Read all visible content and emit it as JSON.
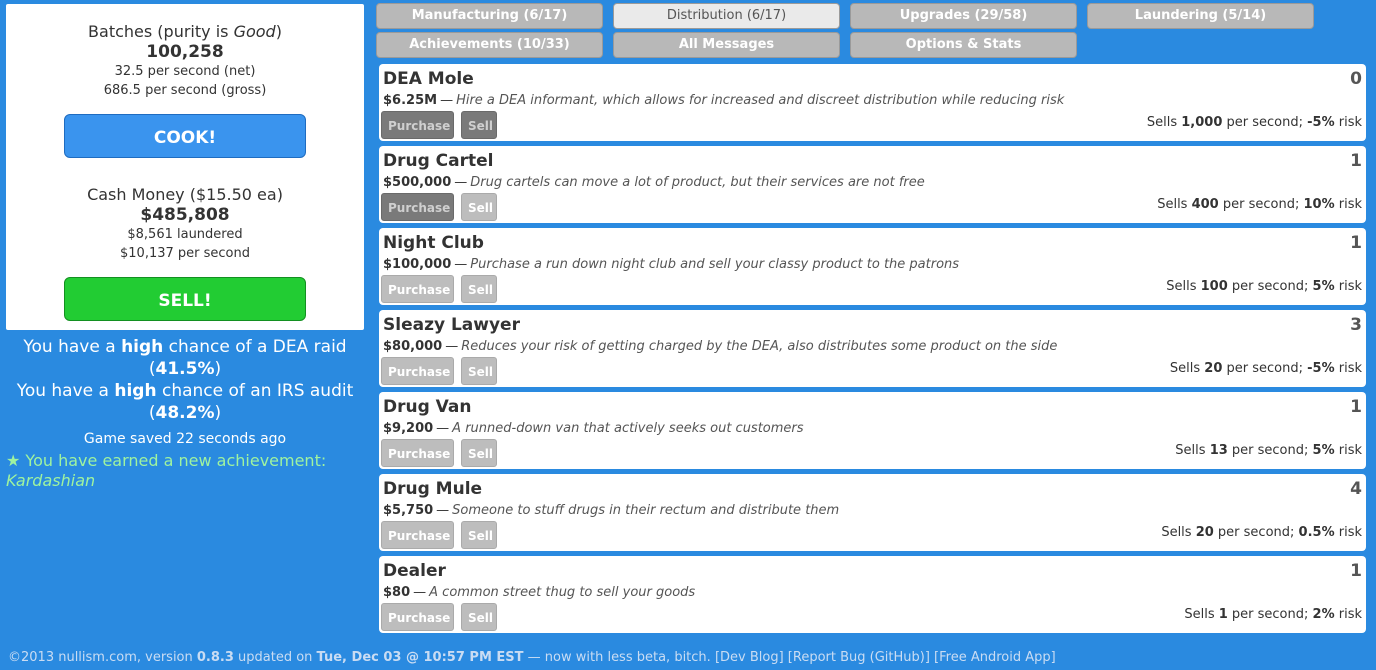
{
  "left": {
    "batches_title_prefix": "Batches (purity is ",
    "batches_purity": "Good",
    "batches_title_suffix": ")",
    "batches_count": "100,258",
    "batches_net": "32.5 per second (net)",
    "batches_gross": "686.5 per second (gross)",
    "cook_label": "COOK!",
    "cash_title": "Cash Money ($15.50 ea)",
    "cash_amount": "$485,808",
    "cash_laundered": "$8,561 laundered",
    "cash_rate": "$10,137 per second",
    "sell_label": "SELL!"
  },
  "risk": {
    "dea_prefix": "You have a ",
    "dea_level": "high",
    "dea_middle": " chance of a DEA raid",
    "dea_pct": "41.5%",
    "irs_prefix": "You have a ",
    "irs_level": "high",
    "irs_middle": " chance of an IRS audit",
    "irs_pct": "48.2%"
  },
  "saved": "Game saved 22 seconds ago",
  "achievement": {
    "star": "★",
    "text": " You have earned a new achievement:",
    "name": "Kardashian"
  },
  "tabs": [
    {
      "label": "Manufacturing (6/17)",
      "active": false
    },
    {
      "label": "Distribution (6/17)",
      "active": true
    },
    {
      "label": "Upgrades (29/58)",
      "active": false
    },
    {
      "label": "Laundering (5/14)",
      "active": false
    },
    {
      "label": "Achievements (10/33)",
      "active": false
    },
    {
      "label": "All Messages",
      "active": false
    },
    {
      "label": "Options & Stats",
      "active": false
    }
  ],
  "items": [
    {
      "name": "DEA Mole",
      "count": "0",
      "price": "$6.25M",
      "dash": "—",
      "desc": "Hire a DEA informant, which allows for increased and discreet distribution while reducing risk",
      "purchase": "Purchase",
      "sell": "Sell",
      "sells_pre": "Sells ",
      "sells_num": "1,000",
      "sells_mid": " per second; ",
      "risk": "-5%",
      "risk_suffix": " risk",
      "purchase_enabled": false,
      "sell_enabled": false
    },
    {
      "name": "Drug Cartel",
      "count": "1",
      "price": "$500,000",
      "dash": "—",
      "desc": "Drug cartels can move a lot of product, but their services are not free",
      "purchase": "Purchase",
      "sell": "Sell",
      "sells_pre": "Sells ",
      "sells_num": "400",
      "sells_mid": " per second; ",
      "risk": "10%",
      "risk_suffix": " risk",
      "purchase_enabled": false,
      "sell_enabled": true
    },
    {
      "name": "Night Club",
      "count": "1",
      "price": "$100,000",
      "dash": "—",
      "desc": "Purchase a run down night club and sell your classy product to the patrons",
      "purchase": "Purchase",
      "sell": "Sell",
      "sells_pre": "Sells ",
      "sells_num": "100",
      "sells_mid": " per second; ",
      "risk": "5%",
      "risk_suffix": " risk",
      "purchase_enabled": true,
      "sell_enabled": true
    },
    {
      "name": "Sleazy Lawyer",
      "count": "3",
      "price": "$80,000",
      "dash": "—",
      "desc": "Reduces your risk of getting charged by the DEA, also distributes some product on the side",
      "purchase": "Purchase",
      "sell": "Sell",
      "sells_pre": "Sells ",
      "sells_num": "20",
      "sells_mid": " per second; ",
      "risk": "-5%",
      "risk_suffix": " risk",
      "purchase_enabled": true,
      "sell_enabled": true
    },
    {
      "name": "Drug Van",
      "count": "1",
      "price": "$9,200",
      "dash": "—",
      "desc": "A runned-down van that actively seeks out customers",
      "purchase": "Purchase",
      "sell": "Sell",
      "sells_pre": "Sells ",
      "sells_num": "13",
      "sells_mid": " per second; ",
      "risk": "5%",
      "risk_suffix": " risk",
      "purchase_enabled": true,
      "sell_enabled": true
    },
    {
      "name": "Drug Mule",
      "count": "4",
      "price": "$5,750",
      "dash": "—",
      "desc": "Someone to stuff drugs in their rectum and distribute them",
      "purchase": "Purchase",
      "sell": "Sell",
      "sells_pre": "Sells ",
      "sells_num": "20",
      "sells_mid": " per second; ",
      "risk": "0.5%",
      "risk_suffix": " risk",
      "purchase_enabled": true,
      "sell_enabled": true
    },
    {
      "name": "Dealer",
      "count": "1",
      "price": "$80",
      "dash": "—",
      "desc": "A common street thug to sell your goods",
      "purchase": "Purchase",
      "sell": "Sell",
      "sells_pre": "Sells ",
      "sells_num": "1",
      "sells_mid": " per second; ",
      "risk": "2%",
      "risk_suffix": " risk",
      "purchase_enabled": true,
      "sell_enabled": true
    }
  ],
  "footer": {
    "copyright": "©2013 nullism.com, version ",
    "version": "0.8.3",
    "updated": " updated on ",
    "date": "Tue, Dec 03 @ 10:57 PM EST",
    "tagline": " — now with less beta, bitch. ",
    "link_devblog": "[Dev Blog]",
    "link_bug": "[Report Bug (GitHub)]",
    "link_android": "[Free Android App]"
  }
}
